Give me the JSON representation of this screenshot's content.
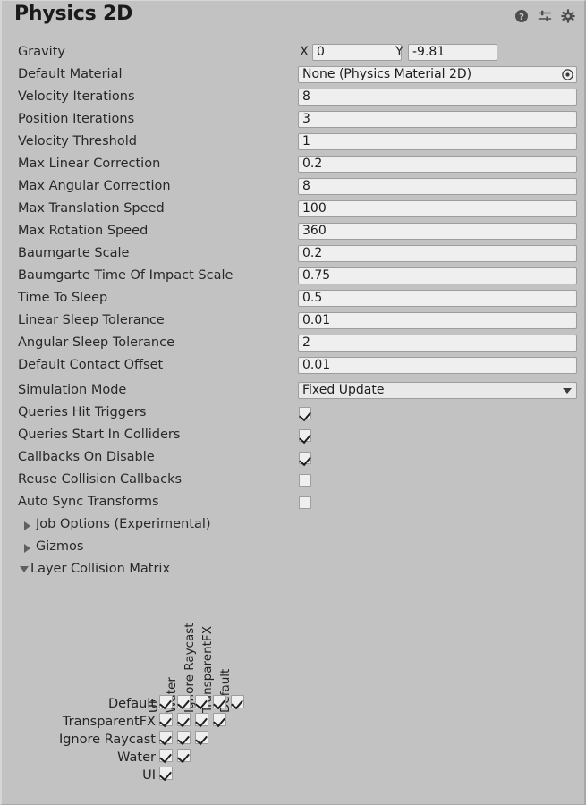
{
  "header": {
    "title": "Physics 2D",
    "icons": [
      {
        "name": "help-icon",
        "label": "Help"
      },
      {
        "name": "preset-icon",
        "label": "Preset"
      },
      {
        "name": "gear-icon",
        "label": "Settings"
      }
    ]
  },
  "properties": [
    {
      "name": "gravity",
      "label": "Gravity",
      "type": "vector2",
      "x_prefix": "X",
      "x_value": "0",
      "y_prefix": "Y",
      "y_value": "-9.81"
    },
    {
      "name": "default-material",
      "label": "Default Material",
      "type": "object",
      "value": "None (Physics Material 2D)"
    },
    {
      "name": "velocity-iterations",
      "label": "Velocity Iterations",
      "type": "number",
      "value": "8"
    },
    {
      "name": "position-iterations",
      "label": "Position Iterations",
      "type": "number",
      "value": "3"
    },
    {
      "name": "velocity-threshold",
      "label": "Velocity Threshold",
      "type": "number",
      "value": "1"
    },
    {
      "name": "max-linear-correction",
      "label": "Max Linear Correction",
      "type": "number",
      "value": "0.2"
    },
    {
      "name": "max-angular-correction",
      "label": "Max Angular Correction",
      "type": "number",
      "value": "8"
    },
    {
      "name": "max-translation-speed",
      "label": "Max Translation Speed",
      "type": "number",
      "value": "100"
    },
    {
      "name": "max-rotation-speed",
      "label": "Max Rotation Speed",
      "type": "number",
      "value": "360"
    },
    {
      "name": "baumgarte-scale",
      "label": "Baumgarte Scale",
      "type": "number",
      "value": "0.2"
    },
    {
      "name": "baumgarte-time-of-impact-scale",
      "label": "Baumgarte Time Of Impact Scale",
      "type": "number",
      "value": "0.75"
    },
    {
      "name": "time-to-sleep",
      "label": "Time To Sleep",
      "type": "number",
      "value": "0.5"
    },
    {
      "name": "linear-sleep-tolerance",
      "label": "Linear Sleep Tolerance",
      "type": "number",
      "value": "0.01"
    },
    {
      "name": "angular-sleep-tolerance",
      "label": "Angular Sleep Tolerance",
      "type": "number",
      "value": "2"
    },
    {
      "name": "default-contact-offset",
      "label": "Default Contact Offset",
      "type": "number",
      "value": "0.01"
    },
    {
      "name": "simulation-mode",
      "label": "Simulation Mode",
      "type": "popup",
      "value": "Fixed Update"
    },
    {
      "name": "queries-hit-triggers",
      "label": "Queries Hit Triggers",
      "type": "toggle",
      "checked": true
    },
    {
      "name": "queries-start-in-colliders",
      "label": "Queries Start In Colliders",
      "type": "toggle",
      "checked": true
    },
    {
      "name": "callbacks-on-disable",
      "label": "Callbacks On Disable",
      "type": "toggle",
      "checked": true
    },
    {
      "name": "reuse-collision-callbacks",
      "label": "Reuse Collision Callbacks",
      "type": "toggle",
      "checked": false
    },
    {
      "name": "auto-sync-transforms",
      "label": "Auto Sync Transforms",
      "type": "toggle",
      "checked": false
    }
  ],
  "foldouts": [
    {
      "name": "job-options",
      "label": "Job Options (Experimental)",
      "expanded": false
    },
    {
      "name": "gizmos",
      "label": "Gizmos",
      "expanded": false
    },
    {
      "name": "layer-collision-matrix",
      "label": "Layer Collision Matrix",
      "expanded": true
    }
  ],
  "layer_collision_matrix": {
    "row_labels": [
      "Default",
      "TransparentFX",
      "Ignore Raycast",
      "Water",
      "UI"
    ],
    "column_labels": [
      "UI",
      "Water",
      "Ignore Raycast",
      "TransparentFX",
      "Default"
    ],
    "checked": [
      [
        true,
        true,
        true,
        true,
        true
      ],
      [
        true,
        true,
        true,
        true
      ],
      [
        true,
        true,
        true
      ],
      [
        true,
        true
      ],
      [
        true
      ]
    ]
  },
  "colors": {
    "panel_background": "#c2c2c2",
    "field_background": "#efefef",
    "field_border": "#9d9d9d",
    "text": "#282828",
    "title": "#1b1b1b"
  }
}
